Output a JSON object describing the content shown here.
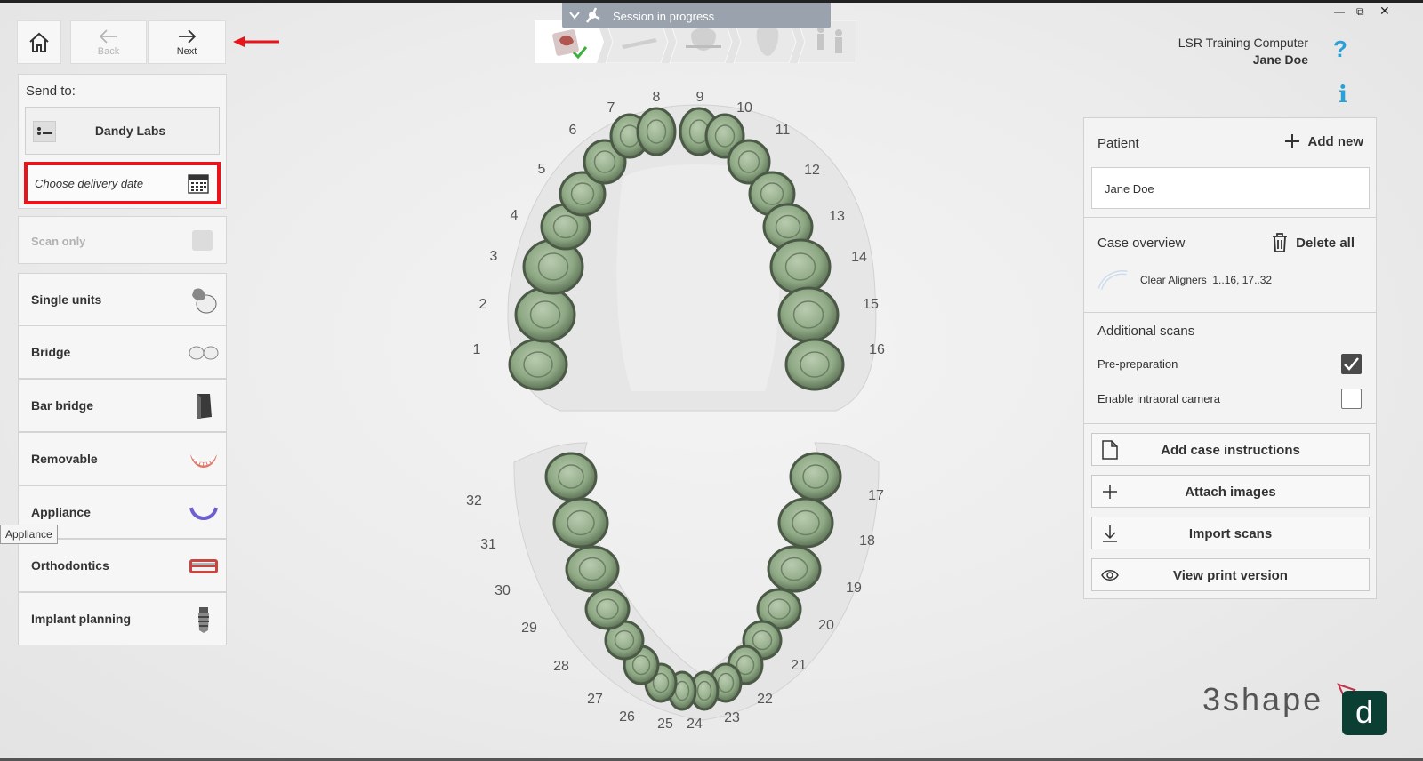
{
  "nav": {
    "back_label": "Back",
    "next_label": "Next"
  },
  "send_to": {
    "title": "Send to:",
    "lab_name": "Dandy Labs",
    "delivery_placeholder": "Choose delivery date",
    "scan_only_label": "Scan only"
  },
  "restorations": [
    {
      "label": "Single units",
      "icon": "crown-icon"
    },
    {
      "label": "Bridge",
      "icon": "bridge-icon"
    },
    {
      "label": "Bar bridge",
      "icon": "bar-bridge-icon"
    },
    {
      "label": "Removable",
      "icon": "denture-icon"
    },
    {
      "label": "Appliance",
      "icon": "appliance-icon"
    },
    {
      "label": "Orthodontics",
      "icon": "orthodontics-icon"
    },
    {
      "label": "Implant planning",
      "icon": "implant-icon"
    }
  ],
  "tooltip": "Appliance",
  "session": {
    "label": "Session in progress"
  },
  "header": {
    "computer": "LSR Training Computer",
    "user": "Jane Doe"
  },
  "patient": {
    "title": "Patient",
    "add_new": "Add new",
    "name": "Jane Doe"
  },
  "case_overview": {
    "title": "Case overview",
    "delete_all": "Delete all",
    "items": [
      {
        "type": "Clear Aligners",
        "teeth": "1..16, 17..32"
      }
    ]
  },
  "additional_scans": {
    "title": "Additional scans",
    "options": [
      {
        "label": "Pre-preparation",
        "checked": true
      },
      {
        "label": "Enable intraoral camera",
        "checked": false
      }
    ]
  },
  "actions": [
    {
      "label": "Add case instructions",
      "icon": "document-icon"
    },
    {
      "label": "Attach images",
      "icon": "plus-icon"
    },
    {
      "label": "Import scans",
      "icon": "download-icon"
    },
    {
      "label": "View print version",
      "icon": "eye-icon"
    }
  ],
  "teeth": {
    "upper": [
      "1",
      "2",
      "3",
      "4",
      "5",
      "6",
      "7",
      "8",
      "9",
      "10",
      "11",
      "12",
      "13",
      "14",
      "15",
      "16"
    ],
    "lower": [
      "17",
      "18",
      "19",
      "20",
      "21",
      "22",
      "23",
      "24",
      "25",
      "26",
      "27",
      "28",
      "29",
      "30",
      "31",
      "32"
    ]
  },
  "brand": {
    "logo_text": "3shape",
    "dandy_letter": "d"
  },
  "colors": {
    "delivery_border": "#e8141c",
    "help_blue": "#2aa1d6",
    "tooth_green": "#8ea884",
    "dandy_green": "#0c3f34"
  }
}
